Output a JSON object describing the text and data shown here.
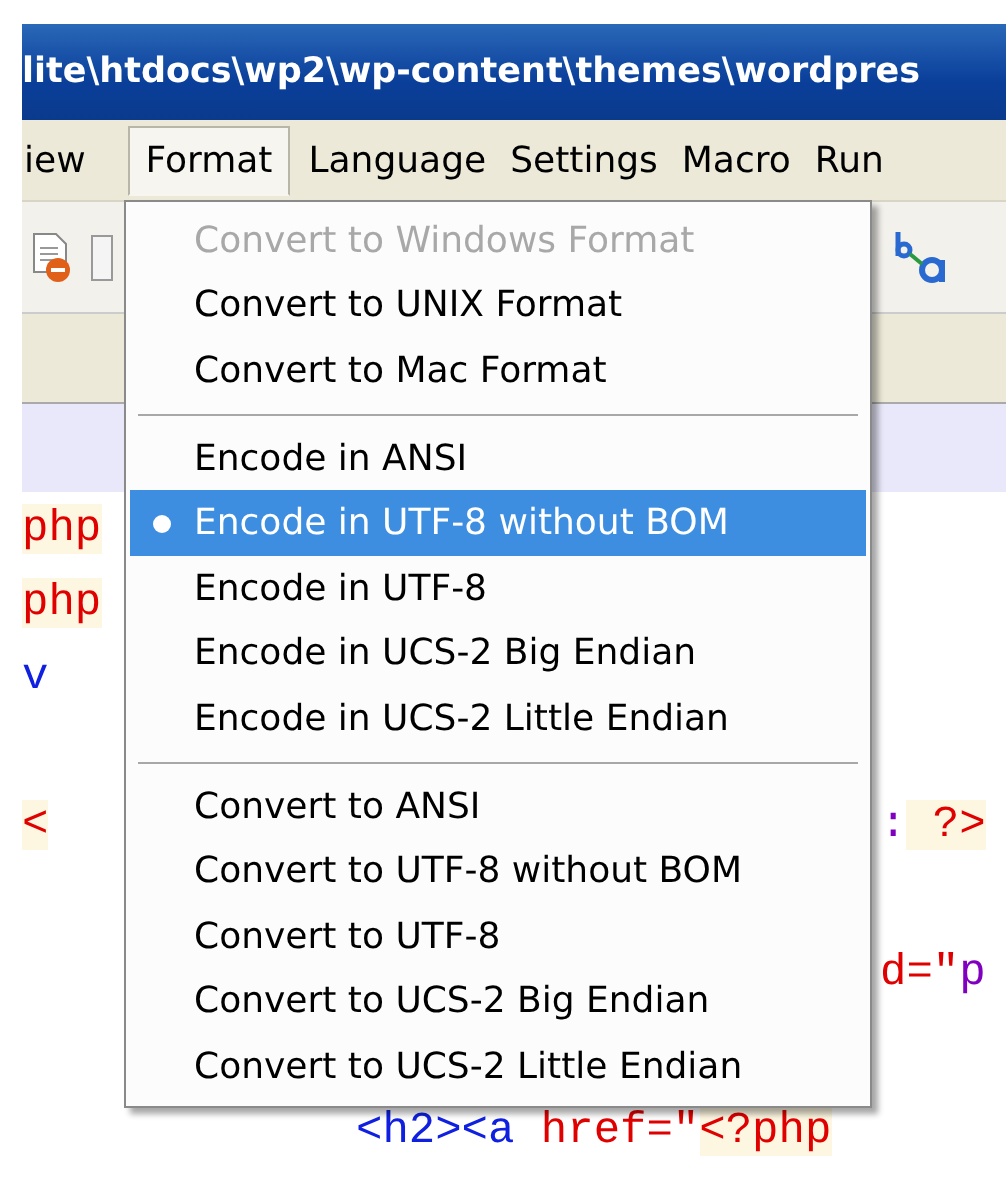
{
  "title_bar": {
    "title": "lite\\htdocs\\wp2\\wp-content\\themes\\wordpres"
  },
  "menu_bar": [
    {
      "label": "iew",
      "selected": false
    },
    {
      "label": "Format",
      "selected": true
    },
    {
      "label": "Language",
      "selected": false
    },
    {
      "label": "Settings",
      "selected": false
    },
    {
      "label": "Macro",
      "selected": false
    },
    {
      "label": "Run",
      "selected": false
    }
  ],
  "code_lines": [
    {
      "kind": "split",
      "left": [
        {
          "text": "php",
          "kind": "keyword",
          "highlight": true
        }
      ]
    },
    {
      "kind": "split",
      "left": [
        {
          "text": "php",
          "kind": "keyword",
          "highlight": true
        }
      ]
    },
    {
      "kind": "split",
      "left": [
        {
          "text": "v",
          "kind": "tag",
          "highlight": false
        }
      ]
    },
    {
      "kind": "blank"
    },
    {
      "kind": "split",
      "left": [
        {
          "text": "<",
          "kind": "keyword",
          "highlight": true
        }
      ],
      "right": [
        {
          "text": ":",
          "kind": "operator",
          "highlight": false
        },
        {
          "text": " ?>",
          "kind": "keyword",
          "highlight": true
        }
      ]
    },
    {
      "kind": "blank"
    },
    {
      "kind": "split",
      "right": [
        {
          "text": "d=\"",
          "kind": "keyword",
          "highlight": false
        },
        {
          "text": "p",
          "kind": "operator",
          "highlight": false
        }
      ]
    },
    {
      "kind": "blank"
    },
    {
      "kind": "indented",
      "body": [
        {
          "text": "<h2><a",
          "kind": "tag",
          "highlight": false
        },
        {
          "text": " href=\"",
          "kind": "keyword",
          "highlight": false
        },
        {
          "text": "<?php",
          "kind": "keyword",
          "highlight": true
        }
      ]
    }
  ],
  "format_menu": {
    "groups": [
      {
        "items": [
          {
            "label": "Convert to Windows Format",
            "disabled": true,
            "checked": false,
            "selected": false
          },
          {
            "label": "Convert to UNIX Format",
            "disabled": false,
            "checked": false,
            "selected": false
          },
          {
            "label": "Convert to Mac Format",
            "disabled": false,
            "checked": false,
            "selected": false
          }
        ]
      },
      {
        "items": [
          {
            "label": "Encode in ANSI",
            "disabled": false,
            "checked": false,
            "selected": false
          },
          {
            "label": "Encode in UTF-8 without BOM",
            "disabled": false,
            "checked": true,
            "selected": true
          },
          {
            "label": "Encode in UTF-8",
            "disabled": false,
            "checked": false,
            "selected": false
          },
          {
            "label": "Encode in UCS-2 Big Endian",
            "disabled": false,
            "checked": false,
            "selected": false
          },
          {
            "label": "Encode in UCS-2 Little Endian",
            "disabled": false,
            "checked": false,
            "selected": false
          }
        ]
      },
      {
        "items": [
          {
            "label": "Convert to ANSI",
            "disabled": false,
            "checked": false,
            "selected": false
          },
          {
            "label": "Convert to UTF-8 without BOM",
            "disabled": false,
            "checked": false,
            "selected": false
          },
          {
            "label": "Convert to UTF-8",
            "disabled": false,
            "checked": false,
            "selected": false
          },
          {
            "label": "Convert to UCS-2 Big Endian",
            "disabled": false,
            "checked": false,
            "selected": false
          },
          {
            "label": "Convert to UCS-2 Little Endian",
            "disabled": false,
            "checked": false,
            "selected": false
          }
        ]
      }
    ]
  }
}
